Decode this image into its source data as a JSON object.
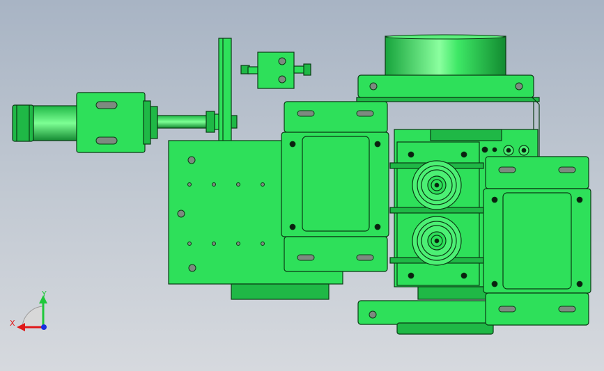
{
  "axes": {
    "x_label": "X",
    "y_label": "Y",
    "x_color": "#e01818",
    "y_color": "#1ec83a",
    "z_color": "#1a2ee0"
  },
  "colors": {
    "background_top": "#a8b4c4",
    "background_bottom": "#d6d9de",
    "part_green": "#2ee05a",
    "edge": "#0a3a14"
  }
}
